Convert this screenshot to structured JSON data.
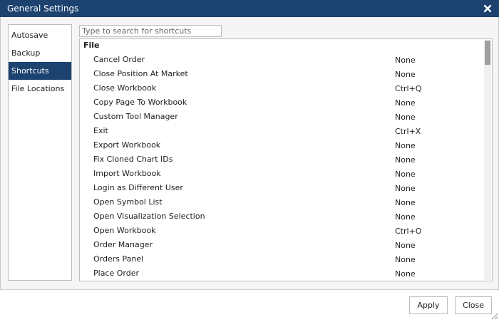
{
  "window": {
    "title": "General Settings",
    "close_icon": "close-icon"
  },
  "sidebar": {
    "items": [
      {
        "label": "Autosave",
        "active": false
      },
      {
        "label": "Backup",
        "active": false
      },
      {
        "label": "Shortcuts",
        "active": true
      },
      {
        "label": "File Locations",
        "active": false
      }
    ]
  },
  "search": {
    "placeholder": "Type to search for shortcuts",
    "value": ""
  },
  "shortcuts": {
    "group": "File",
    "rows": [
      {
        "name": "Cancel Order",
        "key": "None"
      },
      {
        "name": "Close Position At Market",
        "key": "None"
      },
      {
        "name": "Close Workbook",
        "key": "Ctrl+Q"
      },
      {
        "name": "Copy Page To Workbook",
        "key": "None"
      },
      {
        "name": "Custom Tool Manager",
        "key": "None"
      },
      {
        "name": "Exit",
        "key": "Ctrl+X"
      },
      {
        "name": "Export Workbook",
        "key": "None"
      },
      {
        "name": "Fix Cloned Chart IDs",
        "key": "None"
      },
      {
        "name": "Import Workbook",
        "key": "None"
      },
      {
        "name": "Login as Different User",
        "key": "None"
      },
      {
        "name": "Open Symbol List",
        "key": "None"
      },
      {
        "name": "Open Visualization Selection",
        "key": "None"
      },
      {
        "name": "Open Workbook",
        "key": "Ctrl+O"
      },
      {
        "name": "Order Manager",
        "key": "None"
      },
      {
        "name": "Orders Panel",
        "key": "None"
      },
      {
        "name": "Place Order",
        "key": "None"
      }
    ]
  },
  "footer": {
    "apply_label": "Apply",
    "close_label": "Close"
  },
  "colors": {
    "titlebar": "#1c4270",
    "active_item": "#1c4270"
  }
}
